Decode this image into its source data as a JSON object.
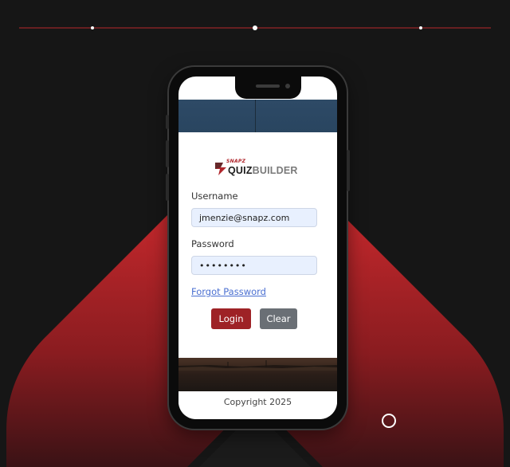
{
  "app": {
    "logo": {
      "snapz": "SNAPZ",
      "quiz": "QUIZ",
      "builder": "BUILDER"
    }
  },
  "login": {
    "username_label": "Username",
    "username_value": "jmenzie@snapz.com",
    "password_label": "Password",
    "password_value": "••••••••",
    "forgot_password": "Forgot Password",
    "login_button": "Login",
    "clear_button": "Clear"
  },
  "footer": {
    "copyright": "Copyright 2025"
  },
  "colors": {
    "brand_red": "#9e2226",
    "clear_gray": "#6a6f75",
    "input_bg": "#e8f0fe",
    "link": "#4a6fd1",
    "page_bg": "#161616"
  },
  "icons": {
    "logo_mark": "snapz-logo-icon",
    "carousel_indicator": "circle-outline-icon"
  }
}
